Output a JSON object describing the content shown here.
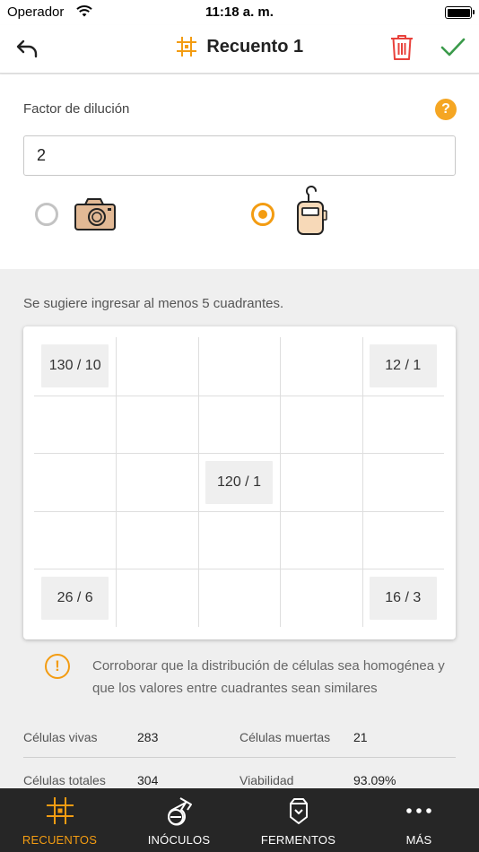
{
  "status_bar": {
    "carrier": "Operador",
    "time": "11:18 a. m."
  },
  "header": {
    "title": "Recuento 1"
  },
  "form": {
    "dilution_label": "Factor de dilución",
    "dilution_value": "2",
    "mode_options": [
      {
        "name": "camera-icon",
        "selected": false
      },
      {
        "name": "hand-counter-icon",
        "selected": true
      }
    ]
  },
  "grid": {
    "hint": "Se sugiere ingresar al menos 5 cuadrantes.",
    "rows": 5,
    "cols": 5,
    "cells": [
      {
        "row": 0,
        "col": 0,
        "value": "130 / 10"
      },
      {
        "row": 0,
        "col": 4,
        "value": "12 / 1"
      },
      {
        "row": 2,
        "col": 2,
        "value": "120 / 1"
      },
      {
        "row": 4,
        "col": 0,
        "value": "26 / 6"
      },
      {
        "row": 4,
        "col": 4,
        "value": "16 / 3"
      }
    ]
  },
  "warning": {
    "text": "Corroborar que la distribución de células sea homogénea y que los valores entre cuadrantes sean similares"
  },
  "stats": {
    "live_label": "Células vivas",
    "live_value": "283",
    "dead_label": "Células muertas",
    "dead_value": "21",
    "total_label": "Células totales",
    "total_value": "304",
    "viability_label": "Viabilidad",
    "viability_value": "93.09%"
  },
  "tabs": [
    {
      "label": "RECUENTOS",
      "icon": "grid-hash-icon",
      "active": true
    },
    {
      "label": "INÓCULOS",
      "icon": "flask-icon",
      "active": false
    },
    {
      "label": "FERMENTOS",
      "icon": "tank-icon",
      "active": false
    },
    {
      "label": "MÁS",
      "icon": "more-dots-icon",
      "active": false
    }
  ],
  "colors": {
    "accent": "#f39c12",
    "danger": "#e8413b",
    "confirm": "#3a9a4a",
    "tabbar_bg": "#262626"
  }
}
